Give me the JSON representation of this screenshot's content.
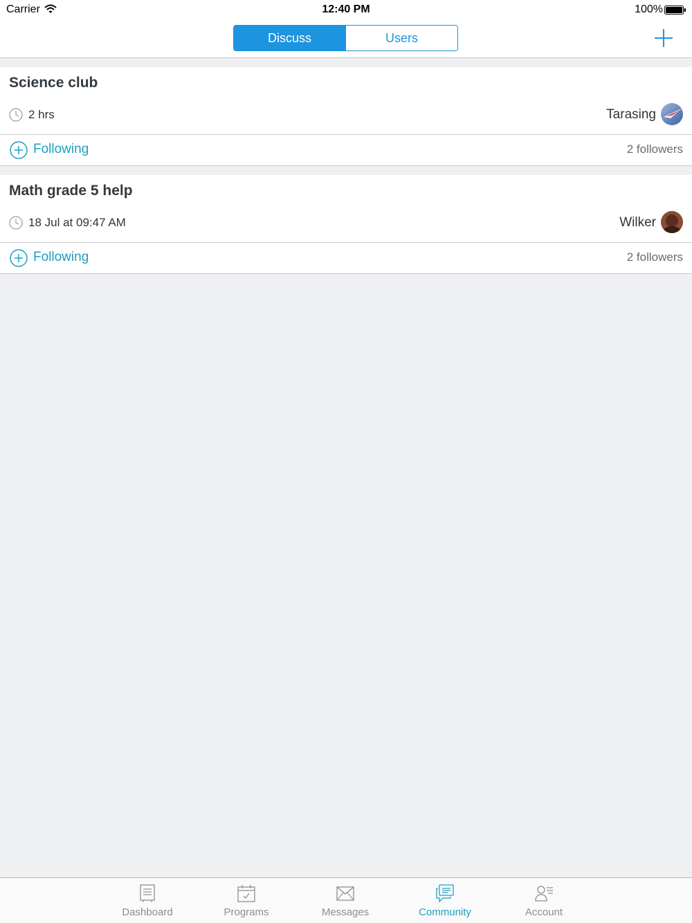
{
  "status_bar": {
    "carrier": "Carrier",
    "time": "12:40 PM",
    "battery": "100%"
  },
  "nav": {
    "segments": [
      "Discuss",
      "Users"
    ],
    "selected": "Discuss"
  },
  "posts": [
    {
      "title": "Science club",
      "time": "2 hrs",
      "author": "Tarasing",
      "follow_label": "Following",
      "followers": "2 followers"
    },
    {
      "title": "Math grade 5 help",
      "time": "18 Jul at 09:47 AM",
      "author": "Wilker",
      "follow_label": "Following",
      "followers": "2 followers"
    }
  ],
  "tabbar": {
    "selected": "Community",
    "tabs": [
      {
        "label": "Dashboard",
        "icon": "dashboard-icon"
      },
      {
        "label": "Programs",
        "icon": "calendar-icon"
      },
      {
        "label": "Messages",
        "icon": "envelope-icon"
      },
      {
        "label": "Community",
        "icon": "chat-icon"
      },
      {
        "label": "Account",
        "icon": "user-list-icon"
      }
    ]
  },
  "colors": {
    "accent": "#1d94e0",
    "link": "#1e9ec1",
    "background": "#eff0f2",
    "inactive": "#8e8e93"
  }
}
